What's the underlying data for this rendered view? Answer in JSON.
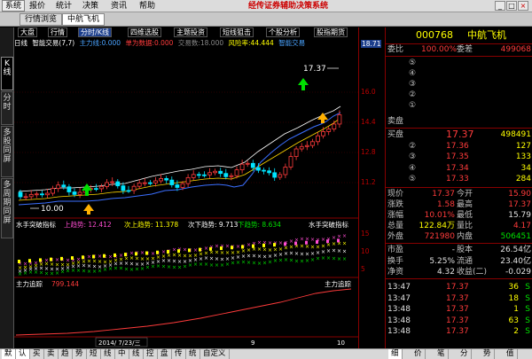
{
  "menu": {
    "items": [
      "系统",
      "报价",
      "统计",
      "决策",
      "资讯",
      "帮助"
    ],
    "app_title": "经传证券辅助决策系统",
    "minimize": "_",
    "maximize": "□",
    "close": "×"
  },
  "tabs": [
    "行情浏览",
    "中航飞机"
  ],
  "left_tabs": [
    "K线",
    "分时",
    "多股同屏",
    "多周期同屏"
  ],
  "period_tabs": [
    "大盘",
    "行情",
    "分时/K线",
    "四维选股",
    "主题投资",
    "短线狙击",
    "个股分析",
    "股指期货"
  ],
  "chart": {
    "legend": {
      "name": "日线",
      "indicator": "智能交易(7,7)",
      "main_force": "主力线:0.000",
      "warning": "单为数据:0.000",
      "trade": "交易数:18.000",
      "risk": "风险率:44.444",
      "smart": "智能交易",
      "price_right": "18.71"
    },
    "high_label": "17.37",
    "low_label": "10.00",
    "indicator2": {
      "title": "水手突破指标",
      "up": "上趋势: 12.412",
      "mid": "次上趋势: 11.378",
      "down1": "次下趋势: 9.713",
      "down2": "下趋势: 8.634",
      "right_title": "水手突破指标"
    },
    "indicator3": {
      "title": "主力追踪",
      "value": "799.144",
      "right_title": "主力追踪"
    },
    "date_label": "2014/ 7/23/三",
    "x_ticks": [
      "9",
      "10"
    ]
  },
  "price_axis": [
    "16.0",
    "14.4",
    "12.8",
    "11.2"
  ],
  "indicator_axis": [
    "15",
    "10",
    "5"
  ],
  "quote": {
    "code": "000768",
    "name": "中航飞机",
    "weibi_label": "委比",
    "weibi": "100.00%",
    "weicha_label": "委差",
    "weicha": "499068",
    "ask_levels": [
      "⑤",
      "④",
      "③",
      "②",
      "①"
    ],
    "sell_label": "卖盘",
    "buy_label": "买盘",
    "bids": [
      {
        "label": "买盘",
        "price": "17.37",
        "vol": "498491"
      },
      {
        "label": "②",
        "price": "17.36",
        "vol": "127"
      },
      {
        "label": "③",
        "price": "17.35",
        "vol": "133"
      },
      {
        "label": "④",
        "price": "17.34",
        "vol": "34"
      },
      {
        "label": "⑤",
        "price": "17.33",
        "vol": "284"
      }
    ],
    "stats": [
      {
        "l1": "现价",
        "v1": "17.37",
        "l2": "今开",
        "v2": "15.90",
        "c1": "red",
        "c2": "red"
      },
      {
        "l1": "涨跌",
        "v1": "1.58",
        "l2": "最高",
        "v2": "17.37",
        "c1": "red",
        "c2": "red"
      },
      {
        "l1": "涨幅",
        "v1": "10.01%",
        "l2": "最低",
        "v2": "15.79",
        "c1": "red",
        "c2": "white"
      },
      {
        "l1": "总量",
        "v1": "122.84万",
        "l2": "量比",
        "v2": "4.17",
        "c1": "yellow",
        "c2": "red"
      },
      {
        "l1": "外盘",
        "v1": "721980",
        "l2": "内盘",
        "v2": "506451",
        "c1": "red",
        "c2": "green"
      }
    ],
    "fin": [
      {
        "l1": "市盈",
        "v1": "-",
        "l2": "股本",
        "v2": "26.54亿"
      },
      {
        "l1": "换手",
        "v1": "5.25%",
        "l2": "流通",
        "v2": "23.40亿"
      },
      {
        "l1": "净资",
        "v1": "4.32",
        "l2": "收益(二)",
        "v2": "-0.029"
      }
    ],
    "ticks": [
      {
        "time": "13:47",
        "price": "17.37",
        "vol": "36",
        "dir": "S"
      },
      {
        "time": "13:47",
        "price": "17.37",
        "vol": "18",
        "dir": "S"
      },
      {
        "time": "13:48",
        "price": "17.37",
        "vol": "1",
        "dir": "S"
      },
      {
        "time": "13:48",
        "price": "17.37",
        "vol": "63",
        "dir": "S"
      },
      {
        "time": "13:48",
        "price": "17.37",
        "vol": "2",
        "dir": "S"
      }
    ]
  },
  "bottom_tabs": [
    "默",
    "认",
    "买",
    "卖",
    "趋",
    "势",
    "短",
    "线",
    "中",
    "线",
    "控",
    "盘",
    "传",
    "统",
    "自定义"
  ],
  "bottom_right": [
    "细",
    "价",
    "笔",
    "分",
    "势",
    "值"
  ]
}
